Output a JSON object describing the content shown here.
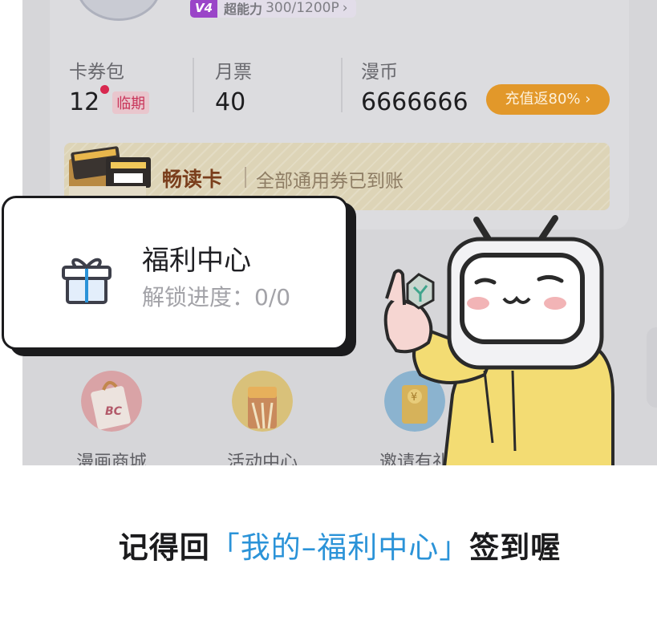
{
  "profile": {
    "vip_level": "V4",
    "power_label": "超能力",
    "power_value": "300/1200P"
  },
  "stats": {
    "coupons": {
      "label": "卡券包",
      "value": "12",
      "tag": "临期"
    },
    "monthly_ticket": {
      "label": "月票",
      "value": "40"
    },
    "coins": {
      "label": "漫币",
      "value": "6666666"
    },
    "recharge_label": "充值返80%"
  },
  "reading_card": {
    "title": "畅读卡",
    "desc": "全部通用券已到账"
  },
  "welfare": {
    "title": "福利中心",
    "progress": "解锁进度：0/0"
  },
  "menu": [
    {
      "label": "漫画商城",
      "icon": "shopping-bag-icon"
    },
    {
      "label": "活动中心",
      "icon": "party-icon"
    },
    {
      "label": "邀请有礼",
      "icon": "invite-coin-icon"
    }
  ],
  "caption": {
    "prefix": "记得回",
    "highlight": "「我的–福利中心」",
    "suffix": "签到喔"
  },
  "colors": {
    "accent_blue": "#2b93d8",
    "recharge_orange": "#e2982a",
    "vip_purple": "#9a45c8",
    "expire_red": "#d8284f"
  }
}
